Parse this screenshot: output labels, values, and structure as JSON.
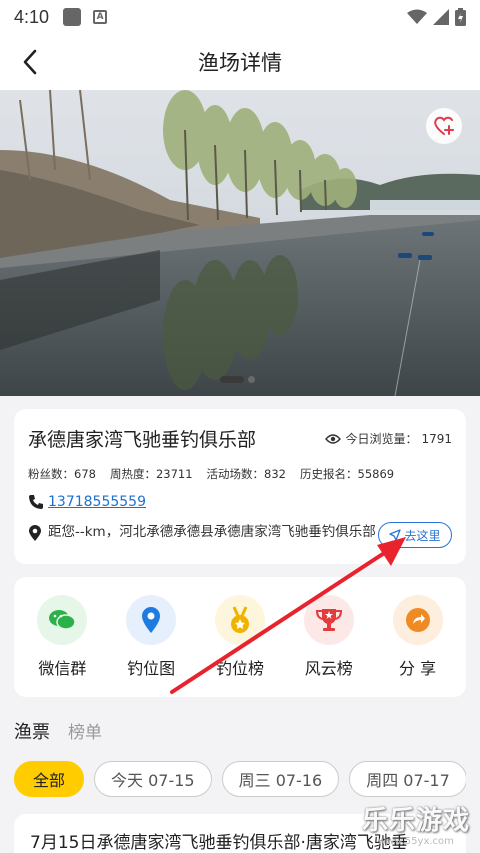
{
  "status_bar": {
    "time": "4:10"
  },
  "nav": {
    "title": "渔场详情"
  },
  "hero": {
    "icon": "heart-plus-icon"
  },
  "club": {
    "name": "承德唐家湾飞驰垂钓俱乐部",
    "views_label": "今日浏览量：",
    "views_count": "1791",
    "stats": {
      "fans": "粉丝数：678",
      "heat": "周热度：23711",
      "events": "活动场数：832",
      "signups": "历史报名：55869"
    },
    "phone": "13718555559",
    "address": "距您--km，河北承德承德县承德唐家湾飞驰垂钓俱乐部",
    "goto_label": "去这里"
  },
  "menu": [
    {
      "label": "微信群",
      "icon": "wechat-icon",
      "color": "#2bb14a"
    },
    {
      "label": "钓位图",
      "icon": "location-pin-icon",
      "color": "#1e7be0"
    },
    {
      "label": "钓位榜",
      "icon": "medal-icon",
      "color": "#f0b400"
    },
    {
      "label": "风云榜",
      "icon": "trophy-icon",
      "color": "#e23c3c"
    },
    {
      "label": "分 享",
      "icon": "share-icon",
      "color": "#f08a24"
    }
  ],
  "tabs": {
    "active": "渔票",
    "other": "榜单"
  },
  "date_chips": [
    "全部",
    "今天 07-15",
    "周三 07-16",
    "周四 07-17"
  ],
  "ticket": {
    "title": "7月15日承德唐家湾飞驰垂钓俱乐部·唐家湾飞驰垂"
  },
  "watermark": {
    "text": "乐乐游戏",
    "sub": "www.55yx.com"
  },
  "colors": {
    "accent": "#ffcc00",
    "link": "#1f6fd1",
    "arrow": "#e8232d"
  }
}
